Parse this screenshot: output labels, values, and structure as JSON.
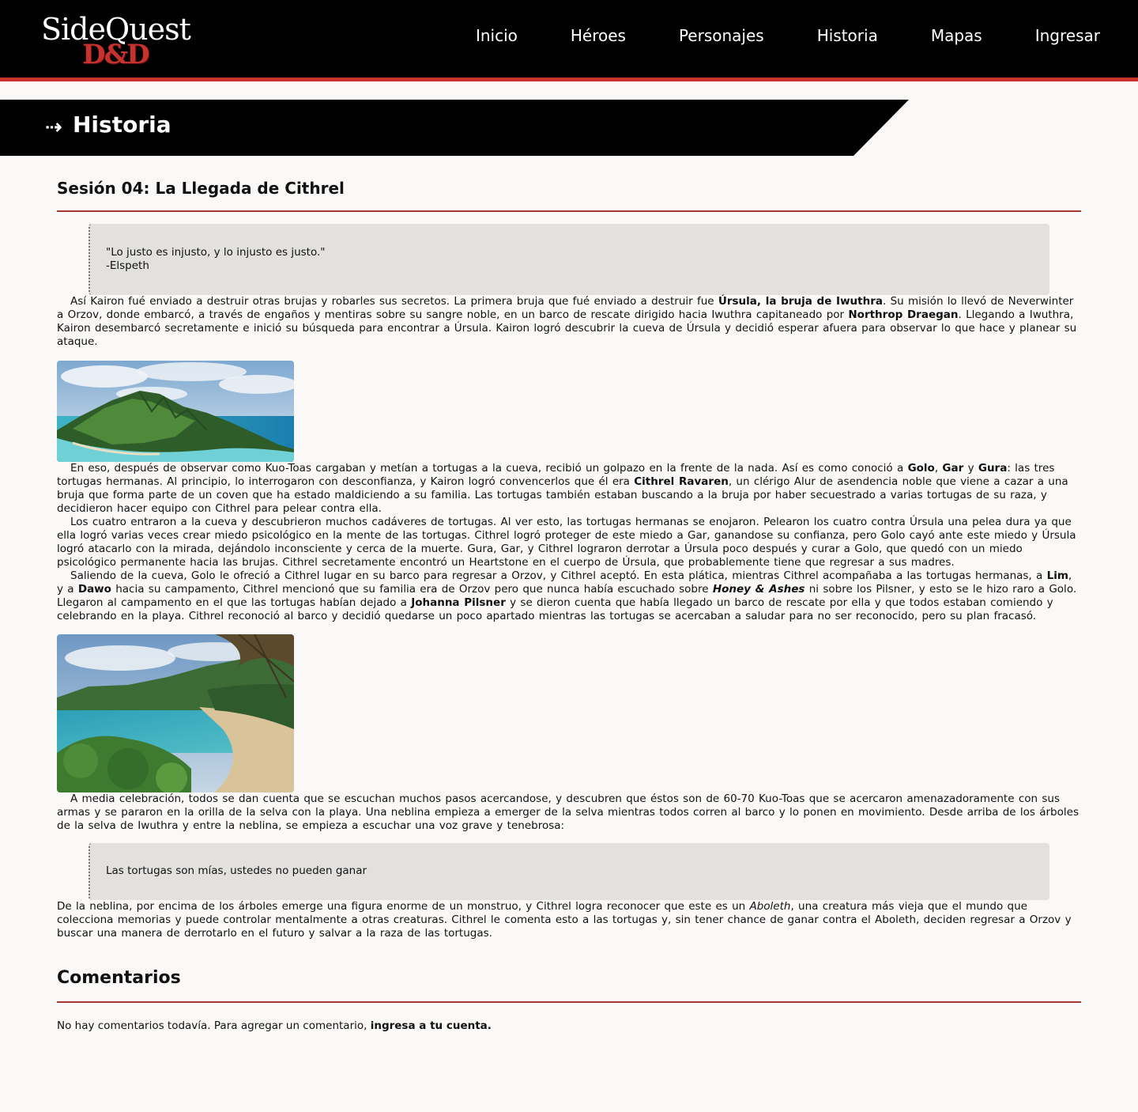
{
  "header": {
    "logo": {
      "side": "Side",
      "quest": "Quest",
      "dnd": "D&D"
    },
    "nav": [
      "Inicio",
      "Héroes",
      "Personajes",
      "Historia",
      "Mapas",
      "Ingresar"
    ]
  },
  "banner": {
    "back_icon": "arrow-left-icon",
    "title": "Historia"
  },
  "session": {
    "title": "Sesión 04: La Llegada de Cithrel"
  },
  "quote1": {
    "line1": "\"Lo justo es injusto, y lo injusto es justo.\"",
    "line2": "-Elspeth"
  },
  "p1": {
    "t1": "Así Kairon fué enviado a destruir otras brujas y robarles sus secretos. La primera bruja que fué enviado a destruir fue ",
    "b1": "Úrsula, la bruja de Iwuthra",
    "t2": ". Su misión lo llevó de Neverwinter a Orzov, donde embarcó, a través de engaños y mentiras sobre su sangre noble, en un barco de rescate dirigido hacia Iwuthra capitaneado por ",
    "b2": "Northrop Draegan",
    "t3": ". Llegando a Iwuthra, Kairon desembarcó secretamente e inició su búsqueda para encontrar a Úrsula. Kairon logró descubrir la cueva de Úrsula y decidió esperar afuera para observar lo que hace y planear su ataque."
  },
  "p2": {
    "t1": "En eso, después de observar como Kuo-Toas cargaban y metían a tortugas a la cueva, recibió un golpazo en la frente de la nada. Así es como conoció a ",
    "b1": "Golo",
    "t2": ", ",
    "b2": "Gar",
    "t3": " y ",
    "b3": "Gura",
    "t4": ": las tres tortugas hermanas. Al principio, lo interrogaron con desconfianza, y Kairon logró convencerlos que él era ",
    "b4": "Cithrel Ravaren",
    "t5": ", un clérigo Alur de asendencia noble que viene a cazar a una bruja que forma parte de un coven que ha estado maldiciendo a su familia. Las tortugas también estaban buscando a la bruja por haber secuestrado a varias tortugas de su raza, y decidieron hacer equipo con Cithrel para pelear contra ella."
  },
  "p3": {
    "text": "Los cuatro entraron a la cueva y descubrieron muchos cadáveres de tortugas. Al ver esto, las tortugas hermanas se enojaron. Pelearon los cuatro contra Úrsula una pelea dura ya que ella logró varias veces crear miedo psicológico en la mente de las tortugas. Cithrel logró proteger de este miedo a Gar, ganandose su confianza, pero Golo cayó ante este miedo y Úrsula logró atacarlo con la mirada, dejándolo inconsciente y cerca de la muerte. Gura, Gar, y Cithrel lograron derrotar a Úrsula poco después y curar a Golo, que quedó con un miedo psicológico permanente hacia las brujas. Cithrel secretamente encontró un Heartstone en el cuerpo de Úrsula, que probablemente tiene que regresar a sus madres."
  },
  "p4": {
    "t1": "Saliendo de la cueva, Golo le ofreció a Cithrel lugar en su barco para regresar a Orzov, y Cithrel aceptó. En esta plática, mientras Cithrel acompañaba a las tortugas hermanas, a ",
    "b1": "Lim",
    "t2": ", y a ",
    "b2": "Dawo",
    "t3": " hacia su campamento, Cithrel mencionó que su familia era de Orzov pero que nunca había escuchado sobre ",
    "bi1": "Honey & Ashes",
    "t4": " ni sobre los Pilsner, y esto se le hizo raro a Golo. Llegaron al campamento en el que las tortugas habían dejado a ",
    "b3": "Johanna Pilsner",
    "t5": " y se dieron cuenta que había llegado un barco de rescate por ella y que todos estaban comiendo y celebrando en la playa. Cithrel reconoció al barco y decidió quedarse un poco apartado mientras las tortugas se acercaban a saludar para no ser reconocido, pero su plan fracasó."
  },
  "p5": {
    "text": "A media celebración, todos se dan cuenta que se escuchan muchos pasos acercandose, y descubren que éstos son de 60-70 Kuo-Toas que se acercaron amenazadoramente con sus armas y se pararon en la orilla de la selva con la playa. Una neblina empieza a emerger de la selva mientras todos corren al barco y lo ponen en movimiento. Desde arriba de los árboles de la selva de Iwuthra y entre la neblina, se empieza a escuchar una voz grave y tenebrosa:"
  },
  "quote2": {
    "line1": "Las tortugas son mías, ustedes no pueden ganar"
  },
  "p6": {
    "t1": "De la neblina, por encima de los árboles emerge una figura enorme de un monstruo, y Cithrel logra reconocer que este es un ",
    "i1": "Aboleth",
    "t2": ", una creatura más vieja que el mundo que colecciona memorias y puede controlar mentalmente a otras creaturas. Cithrel le comenta esto a las tortugas y, sin tener chance de ganar contra el Aboleth, deciden regresar a Orzov y buscar una manera de derrotarlo en el futuro y salvar a la raza de las tortugas."
  },
  "comments": {
    "title": "Comentarios",
    "text": "No hay comentarios todavía. Para agregar un comentario, ",
    "link": "ingresa a tu cuenta."
  },
  "colors": {
    "accent": "#c8322d",
    "header_bg": "#000000",
    "quote_bg": "#e2e1df",
    "page_bg": "#faf9f7"
  }
}
